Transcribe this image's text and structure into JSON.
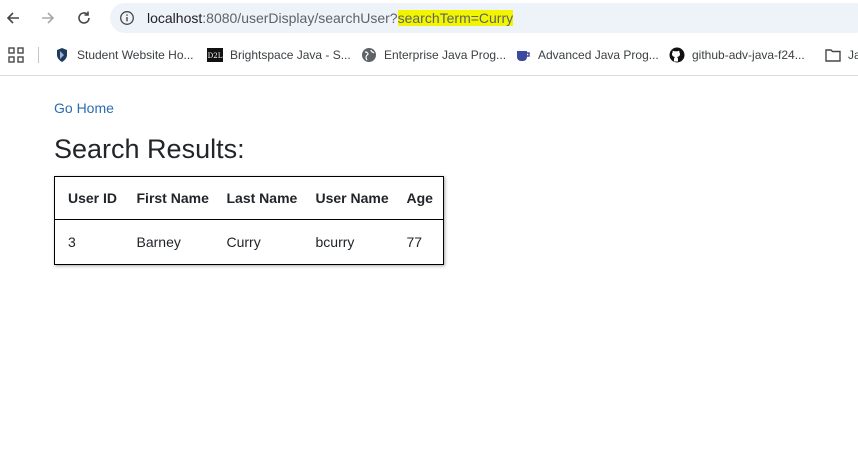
{
  "browser": {
    "url_host": "localhost",
    "url_rest": ":8080/userDisplay/searchUser?",
    "url_query": "searchTerm=Curry"
  },
  "bookmarks": [
    {
      "label": "Student Website Ho...",
      "icon": "shield-bookmark-icon"
    },
    {
      "label": "Brightspace Java - S...",
      "icon": "d2l-icon"
    },
    {
      "label": "Enterprise Java Prog...",
      "icon": "globe-icon"
    },
    {
      "label": "Advanced Java Prog...",
      "icon": "mug-icon"
    },
    {
      "label": "github-adv-java-f24...",
      "icon": "github-icon"
    },
    {
      "label": "Ja",
      "icon": "folder-icon"
    }
  ],
  "page": {
    "go_home": "Go Home",
    "title": "Search Results:"
  },
  "table": {
    "headers": [
      "User ID",
      "First Name",
      "Last Name",
      "User Name",
      "Age"
    ],
    "rows": [
      [
        "3",
        "Barney",
        "Curry",
        "bcurry",
        "77"
      ]
    ]
  },
  "colors": {
    "link": "#2a6db0",
    "highlight": "#f2f500",
    "omnibox": "#eef2f9"
  }
}
